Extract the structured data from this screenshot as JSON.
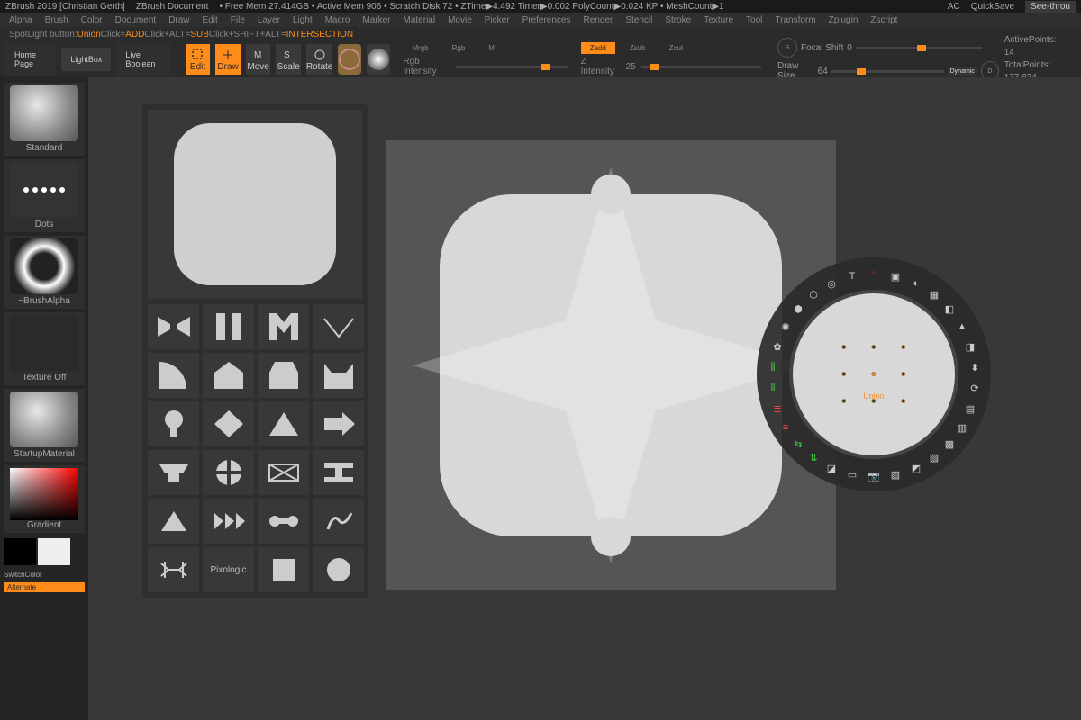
{
  "title": {
    "app": "ZBrush 2019 [Christian Gerth]",
    "doc": "ZBrush Document",
    "mem": "• Free Mem 27.414GB • Active Mem 906 • Scratch Disk 72 • ZTime▶4.492 Timer▶0.002 PolyCount▶0.024 KP • MeshCount▶1",
    "ac": "AC",
    "quicksave": "QuickSave",
    "seethrough": "See-throu"
  },
  "menu": [
    "Alpha",
    "Brush",
    "Color",
    "Document",
    "Draw",
    "Edit",
    "File",
    "Layer",
    "Light",
    "Macro",
    "Marker",
    "Material",
    "Movie",
    "Picker",
    "Preferences",
    "Render",
    "Stencil",
    "Stroke",
    "Texture",
    "Tool",
    "Transform",
    "Zplugin",
    "Zscript"
  ],
  "info": {
    "label": "SpotLight button:",
    "val": "Union",
    "click": "  Click=",
    "add": "ADD",
    "clickalt": "  Click+ALT=",
    "sub": "SUB",
    "clickshift": "  Click+SHIFT+ALT=",
    "inter": "INTERSECTION"
  },
  "tabs": {
    "home": "Home Page",
    "lightbox": "LightBox",
    "live": "Live Boolean"
  },
  "tools": {
    "edit": "Edit",
    "draw": "Draw",
    "move": "Move",
    "scale": "Scale",
    "rotate": "Rotate"
  },
  "color": {
    "mrgb": "Mrgb",
    "rgb": "Rgb",
    "m": "M",
    "rgbint": "Rgb Intensity"
  },
  "z": {
    "zadd": "Zadd",
    "zsub": "Zsub",
    "zcut": "Zcut",
    "zint": "Z Intensity",
    "zintval": "25"
  },
  "brush": {
    "focal": "Focal Shift",
    "focalval": "0",
    "size": "Draw Size",
    "sizeval": "64",
    "dynamic": "Dynamic",
    "s": "S",
    "d": "D"
  },
  "stats": {
    "active": "ActivePoints:",
    "activeval": "14",
    "total": "TotalPoints:",
    "totalval": "177,624"
  },
  "palette": {
    "standard": "Standard",
    "dotsname": "Dots",
    "brushalpha": "~BrushAlpha",
    "texoff": "Texture Off",
    "startup": "StartupMaterial",
    "gradient": "Gradient",
    "switchc": "SwitchColor",
    "alternate": "Alternate"
  },
  "pixologic": "Pixologic",
  "radial_center": "Union"
}
